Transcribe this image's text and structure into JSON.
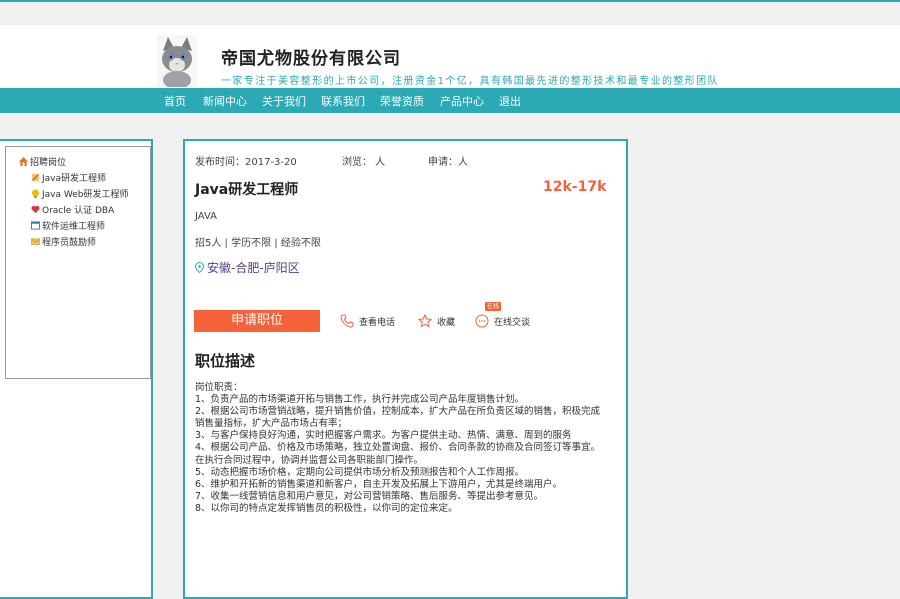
{
  "header": {
    "company": "帝国尤物股份有限公司",
    "slogan": "一家专注于美容整形的上市公司，注册资金1个亿，具有韩国最先进的整形技术和最专业的整形团队"
  },
  "nav": [
    "首页",
    "新闻中心",
    "关于我们",
    "联系我们",
    "荣誉资质",
    "产品中心",
    "退出"
  ],
  "sidebar": {
    "root": "招聘岗位",
    "items": [
      "Java研发工程师",
      "Java Web研发工程师",
      "Oracle 认证 DBA",
      "软件运维工程师",
      "程序员鼓励师"
    ]
  },
  "job": {
    "publish_label": "发布时间：",
    "publish_date": "2017-3-20",
    "views": "浏览：  人",
    "applies": "申请：人",
    "title": "Java研发工程师",
    "salary": "12k-17k",
    "skill": "JAVA",
    "requirements": "招5人 | 学历不限 | 经验不限",
    "location": "安徽-合肥-庐阳区",
    "apply_button": "申请职位",
    "actions": {
      "phone": "查看电话",
      "favorite": "收藏",
      "chat": "在线交谈",
      "chat_badge": "在线"
    },
    "desc_title": "职位描述",
    "desc_lines": [
      "岗位职责：",
      "1、负责产品的市场渠道开拓与销售工作，执行并完成公司产品年度销售计划。",
      "2、根据公司市场营销战略，提升销售价值，控制成本，扩大产品在所负责区域的销售，积极完成",
      "销售量指标，扩大产品市场占有率；",
      "3、与客户保持良好沟通，实时把握客户需求。为客户提供主动、热情、满意、周到的服务",
      "4、根据公司产品、价格及市场策略，独立处置询盘、报价、合同条款的协商及合同签订等事宜。",
      "在执行合同过程中，协调并监督公司各职能部门操作。",
      "5、动态把握市场价格，定期向公司提供市场分析及预测报告和个人工作周报。",
      "6、维护和开拓新的销售渠道和新客户，自主开发及拓展上下游用户，尤其是终端用户。",
      "7、收集一线营销信息和用户意见，对公司营销策略、售后服务、等提出参考意见。",
      "8、以你司的特点定发挥销售员的积极性，以你司的定位来定。"
    ]
  },
  "colors": {
    "accent": "#2ba9b4",
    "salary": "#f4623a",
    "button": "#f4623a"
  }
}
